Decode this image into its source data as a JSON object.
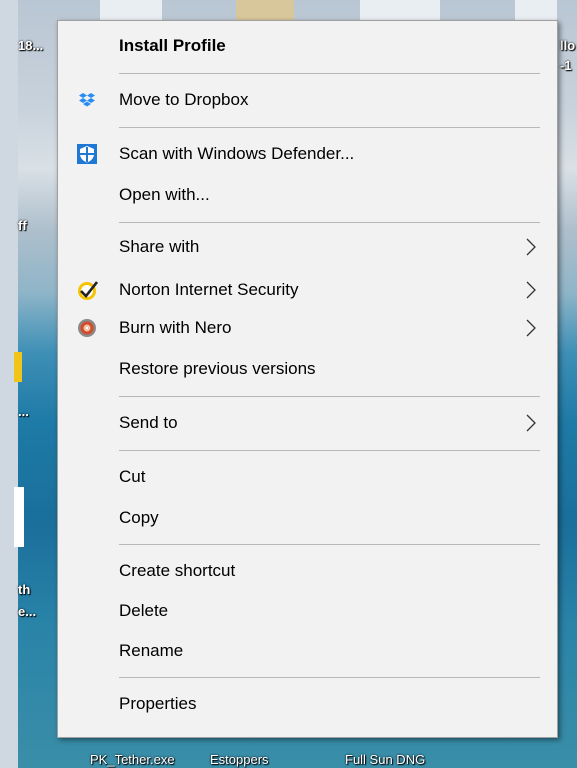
{
  "desktop": {
    "labels": {
      "top_left": "18...",
      "top_right": "llo",
      "top_right2": "-1",
      "mid_left": "ff",
      "left_file": "...",
      "left_bottom1": "th",
      "left_bottom2": "e...",
      "bottom_labels": [
        "PK_Tether.exe",
        "Estoppers",
        "Full Sun DNG"
      ]
    }
  },
  "context_menu": {
    "items": [
      {
        "label": "Install Profile"
      },
      {
        "label": "Move to Dropbox"
      },
      {
        "label": "Scan with Windows Defender..."
      },
      {
        "label": "Open with..."
      },
      {
        "label": "Share with"
      },
      {
        "label": "Norton Internet Security"
      },
      {
        "label": "Burn with Nero"
      },
      {
        "label": "Restore previous versions"
      },
      {
        "label": "Send to"
      },
      {
        "label": "Cut"
      },
      {
        "label": "Copy"
      },
      {
        "label": "Create shortcut"
      },
      {
        "label": "Delete"
      },
      {
        "label": "Rename"
      },
      {
        "label": "Properties"
      }
    ]
  },
  "colors": {
    "menu_bg": "#f2f2f2",
    "separator": "#b8b8b8",
    "dropbox_blue": "#2a8cf0",
    "defender_blue": "#1e78d4",
    "norton_yellow": "#f5c400"
  }
}
